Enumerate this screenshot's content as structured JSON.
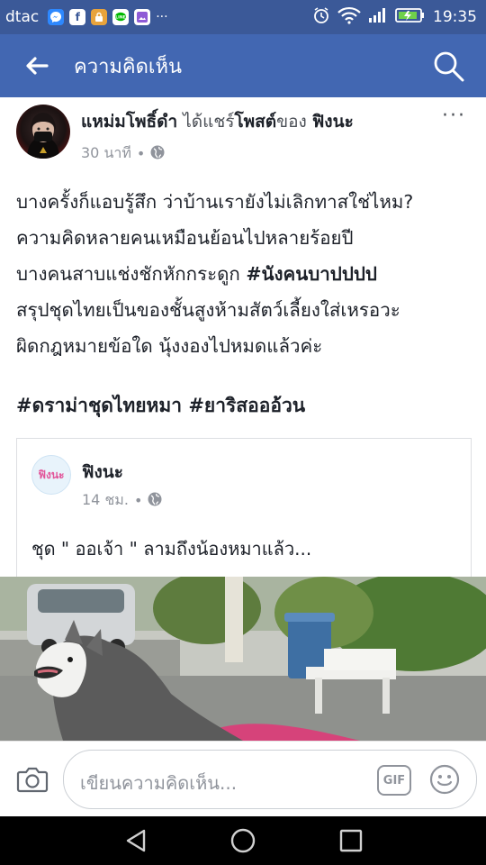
{
  "status_bar": {
    "carrier": "dtac",
    "time": "19:35",
    "notification_icons": [
      "messenger-icon",
      "facebook-icon",
      "lock-app-icon",
      "line-icon",
      "gallery-icon"
    ],
    "more": "···"
  },
  "header": {
    "title": "ความคิดเห็น"
  },
  "post": {
    "author": "แหม่มโพธิ์ดำ",
    "shared_text": "ได้แชร์",
    "post_word": "โพสต์",
    "of_text": "ของ",
    "source_page": "ฟิงนะ",
    "time": "30 นาที",
    "dot": "•",
    "more": "···",
    "lines": [
      "บางครั้งก็แอบรู้สึก ว่าบ้านเรายังไม่เลิกทาสใช่ไหม?",
      "ความคิดหลายคนเหมือนย้อนไปหลายร้อยปี",
      "บางคนสาบแช่งชักหักกระดูก ",
      "สรุปชุดไทยเป็นของชั้นสูงห้ามสัตว์เลี้ยงใส่เหรอวะ",
      "ผิดกฎหมายข้อใด นุ้งงองไปหมดแล้วค่ะ"
    ],
    "inline_hashtag": "#นังคนบาปปปป",
    "hashtags": "#ดราม่าชุดไทยหมา #ยาริสอออ้วน"
  },
  "shared_post": {
    "avatar_text": "ฟิงนะ",
    "name": "ฟิงนะ",
    "time": "14 ชม.",
    "dot": "•",
    "text": "ชุด \" ออเจ้า \" ลามถึงน้องหมาแล้ว..."
  },
  "composer": {
    "placeholder": "เขียนความคิดเห็น...",
    "gif_label": "GIF"
  },
  "colors": {
    "status_bar": "#3b5998",
    "header": "#4267b2",
    "text": "#1d2129",
    "meta": "#90949c"
  }
}
